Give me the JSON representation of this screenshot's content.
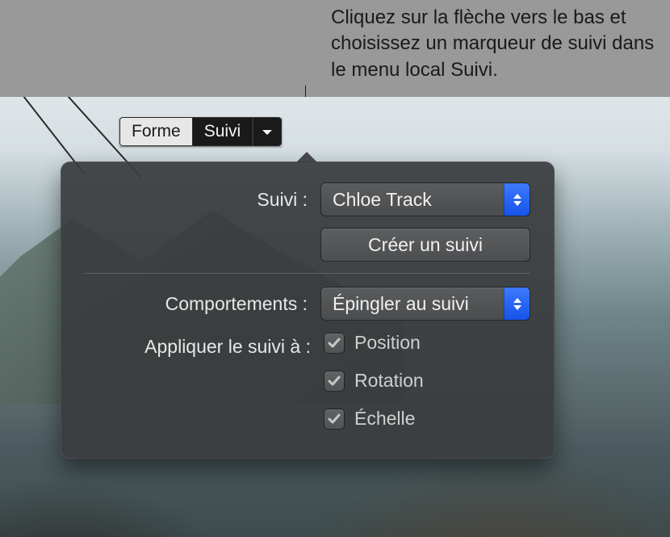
{
  "callout": "Cliquez sur la flèche vers le bas et choisissez un marqueur de suivi dans le menu local Suivi.",
  "toolbar": {
    "forme_label": "Forme",
    "suivi_label": "Suivi"
  },
  "popover": {
    "suivi_label": "Suivi :",
    "track_selected": "Chloe Track",
    "create_button": "Créer un suivi",
    "comportements_label": "Comportements :",
    "behavior_selected": "Épingler au suivi",
    "apply_label": "Appliquer le suivi à :",
    "checks": {
      "position": {
        "label": "Position",
        "checked": true
      },
      "rotation": {
        "label": "Rotation",
        "checked": true
      },
      "echelle": {
        "label": "Échelle",
        "checked": true
      }
    }
  }
}
